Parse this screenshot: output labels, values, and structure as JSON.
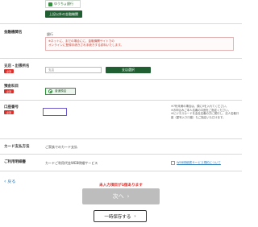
{
  "bank": {
    "logo_text": "ゆうちょ銀行",
    "select_button": "上記以外の金融機関"
  },
  "fields": {
    "bank_name": {
      "label": "金融機関名",
      "value": "銀行"
    },
    "notice": {
      "line1": "※ネットに、まだの場合にに、金融機関サイトでの",
      "line2": "オンラインに登録手続きされ手続きする試料いたします。"
    },
    "branch": {
      "label": "支店・出張所名",
      "required": "必須",
      "input_value": "支店",
      "select_button": "支店選択"
    },
    "deposit_type": {
      "label": "預金科目",
      "required": "必須",
      "option": "普通預金"
    },
    "account_number": {
      "label": "口座番号",
      "required": "必須",
      "input_value": "",
      "notes": [
        "※7桁未満の場合は、頭に0を入れてください。",
        "※お申込みご本人名義の口座をご指定ください。",
        "※ビジネスカードを会社名義の方に発行し、法人名義口座（屋号入り口座）もご指定いただけます。"
      ]
    },
    "transfer_method": {
      "label": "カード支払方法",
      "value": "ご家族でのカード支払"
    },
    "payment_details": {
      "label": "ご利用明細書",
      "value": "カードご利用代金WEB明細サービス",
      "terms_link": "WEB明細書サービス規約について"
    }
  },
  "nav": {
    "back": "戻る",
    "error": "未入力項目が1個あります",
    "next_button": "次へ",
    "save_button": "一時保存する"
  },
  "colors": {
    "accent_green": "#1f5f32",
    "required_red": "#d9302c",
    "link_blue": "#2a7ab8"
  }
}
